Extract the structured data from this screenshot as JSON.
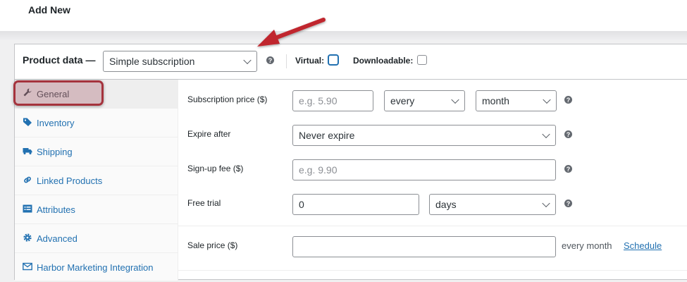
{
  "page": {
    "title": "Add New"
  },
  "product_data": {
    "label": "Product data —",
    "type_select": "Simple subscription",
    "virtual_label": "Virtual:",
    "downloadable_label": "Downloadable:",
    "help_glyph": "?"
  },
  "tabs": [
    {
      "label": "General",
      "icon": "wrench-icon",
      "active": true
    },
    {
      "label": "Inventory",
      "icon": "tag-icon"
    },
    {
      "label": "Shipping",
      "icon": "truck-icon"
    },
    {
      "label": "Linked Products",
      "icon": "link-icon"
    },
    {
      "label": "Attributes",
      "icon": "list-icon"
    },
    {
      "label": "Advanced",
      "icon": "gear-icon"
    },
    {
      "label": "Harbor Marketing Integration",
      "icon": "envelope-icon"
    }
  ],
  "fields": {
    "subscription_price": {
      "label": "Subscription price ($)",
      "placeholder": "e.g. 5.90",
      "interval": "every",
      "period": "month"
    },
    "expire_after": {
      "label": "Expire after",
      "value": "Never expire"
    },
    "signup_fee": {
      "label": "Sign-up fee ($)",
      "placeholder": "e.g. 9.90"
    },
    "free_trial": {
      "label": "Free trial",
      "value": "0",
      "unit": "days"
    },
    "sale_price": {
      "label": "Sale price ($)",
      "value": "",
      "suffix": "every month",
      "schedule_link": "Schedule"
    }
  },
  "colors": {
    "accent": "#2271b1",
    "highlight": "#a5333d",
    "arrow": "#c0272d"
  }
}
